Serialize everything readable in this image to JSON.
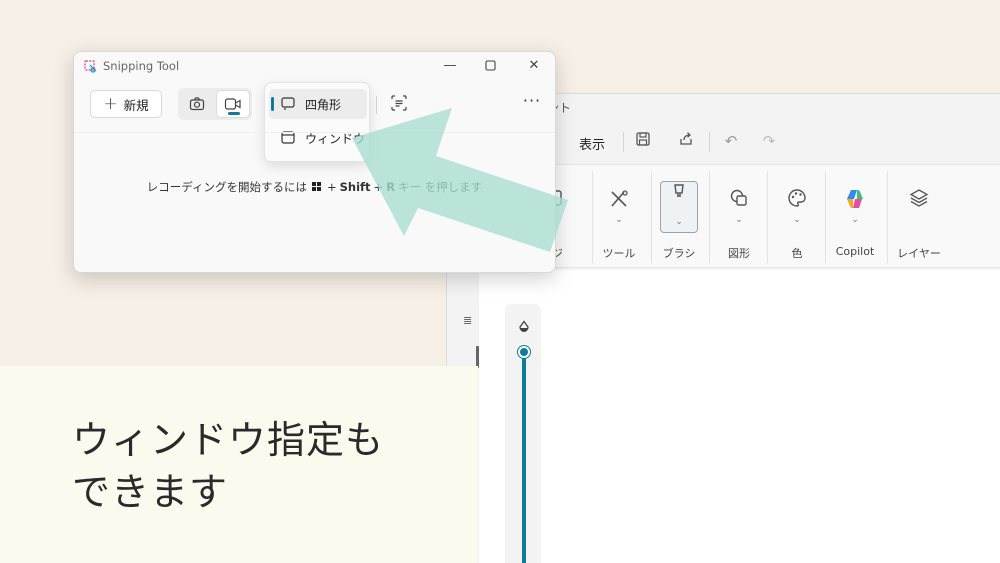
{
  "paint": {
    "title_partial": "ント",
    "menu": {
      "view_label": "表示"
    },
    "ribbon": {
      "image_label": "ージ",
      "tools_label": "ツール",
      "brush_label": "ブラシ",
      "shapes_label": "図形",
      "color_label": "色",
      "copilot_label": "Copilot",
      "layers_label": "レイヤー"
    }
  },
  "snipping_tool": {
    "title": "Snipping Tool",
    "new_label": "新規",
    "mode_dropdown": {
      "items": [
        {
          "label": "四角形",
          "selected": true
        },
        {
          "label": "ウィンドウ",
          "selected": false
        }
      ]
    },
    "hint": {
      "prefix": "レコーディングを開始するには",
      "plus1": "+",
      "shift": "Shift",
      "plus2": "+",
      "r_key": "R",
      "suffix": "キー を押します"
    }
  },
  "caption": {
    "line1": "ウィンドウ指定も",
    "line2": "できます"
  },
  "colors": {
    "accent": "#0f7b9b",
    "arrow": "#a8dccf",
    "page_background": "#f6efe6",
    "caption_background": "#fbfaef"
  }
}
